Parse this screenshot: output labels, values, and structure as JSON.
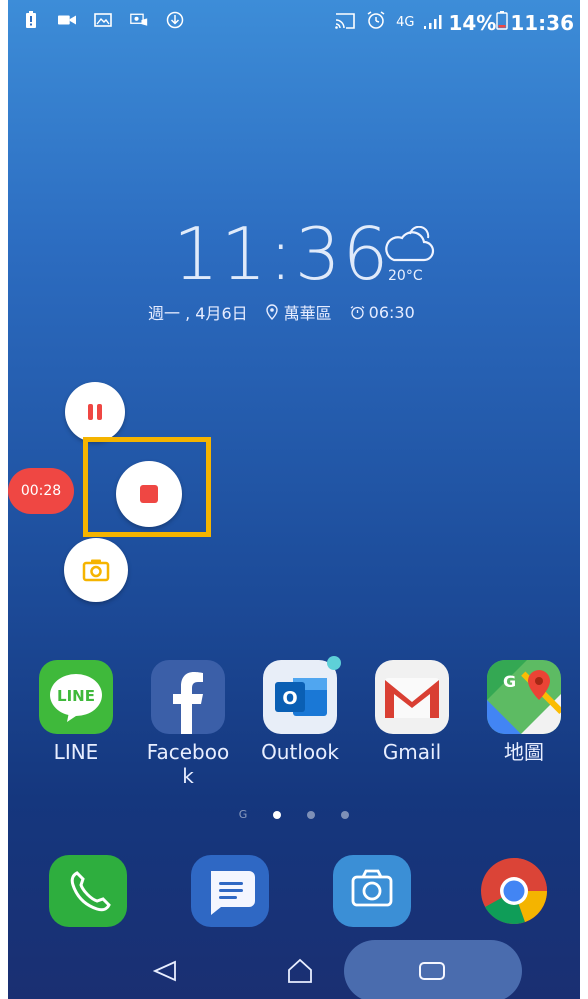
{
  "status_bar": {
    "signal_type": "4G",
    "battery_percent": "14%",
    "time": "11:36"
  },
  "lock_widget": {
    "clock": "11:36",
    "temperature": "20°C",
    "date": "週一 , 4月6日",
    "location": "萬華區",
    "alarm": "06:30"
  },
  "recorder": {
    "elapsed": "00:28",
    "highlight_color": "#f5b400",
    "stop_color": "#ef4743"
  },
  "apps": [
    {
      "label": "LINE",
      "icon": "line-icon"
    },
    {
      "label": "Faceboo\nk",
      "icon": "facebook-icon"
    },
    {
      "label": "Outlook",
      "icon": "outlook-icon"
    },
    {
      "label": "Gmail",
      "icon": "gmail-icon"
    },
    {
      "label": "地圖",
      "icon": "maps-icon"
    }
  ],
  "page_indicator": {
    "google_label": "G",
    "pages": 3,
    "active_page": 1
  },
  "dock": [
    "phone-icon",
    "messages-icon",
    "camera-icon",
    "chrome-icon"
  ],
  "navigation": [
    "back-icon",
    "home-icon",
    "recents-icon"
  ]
}
